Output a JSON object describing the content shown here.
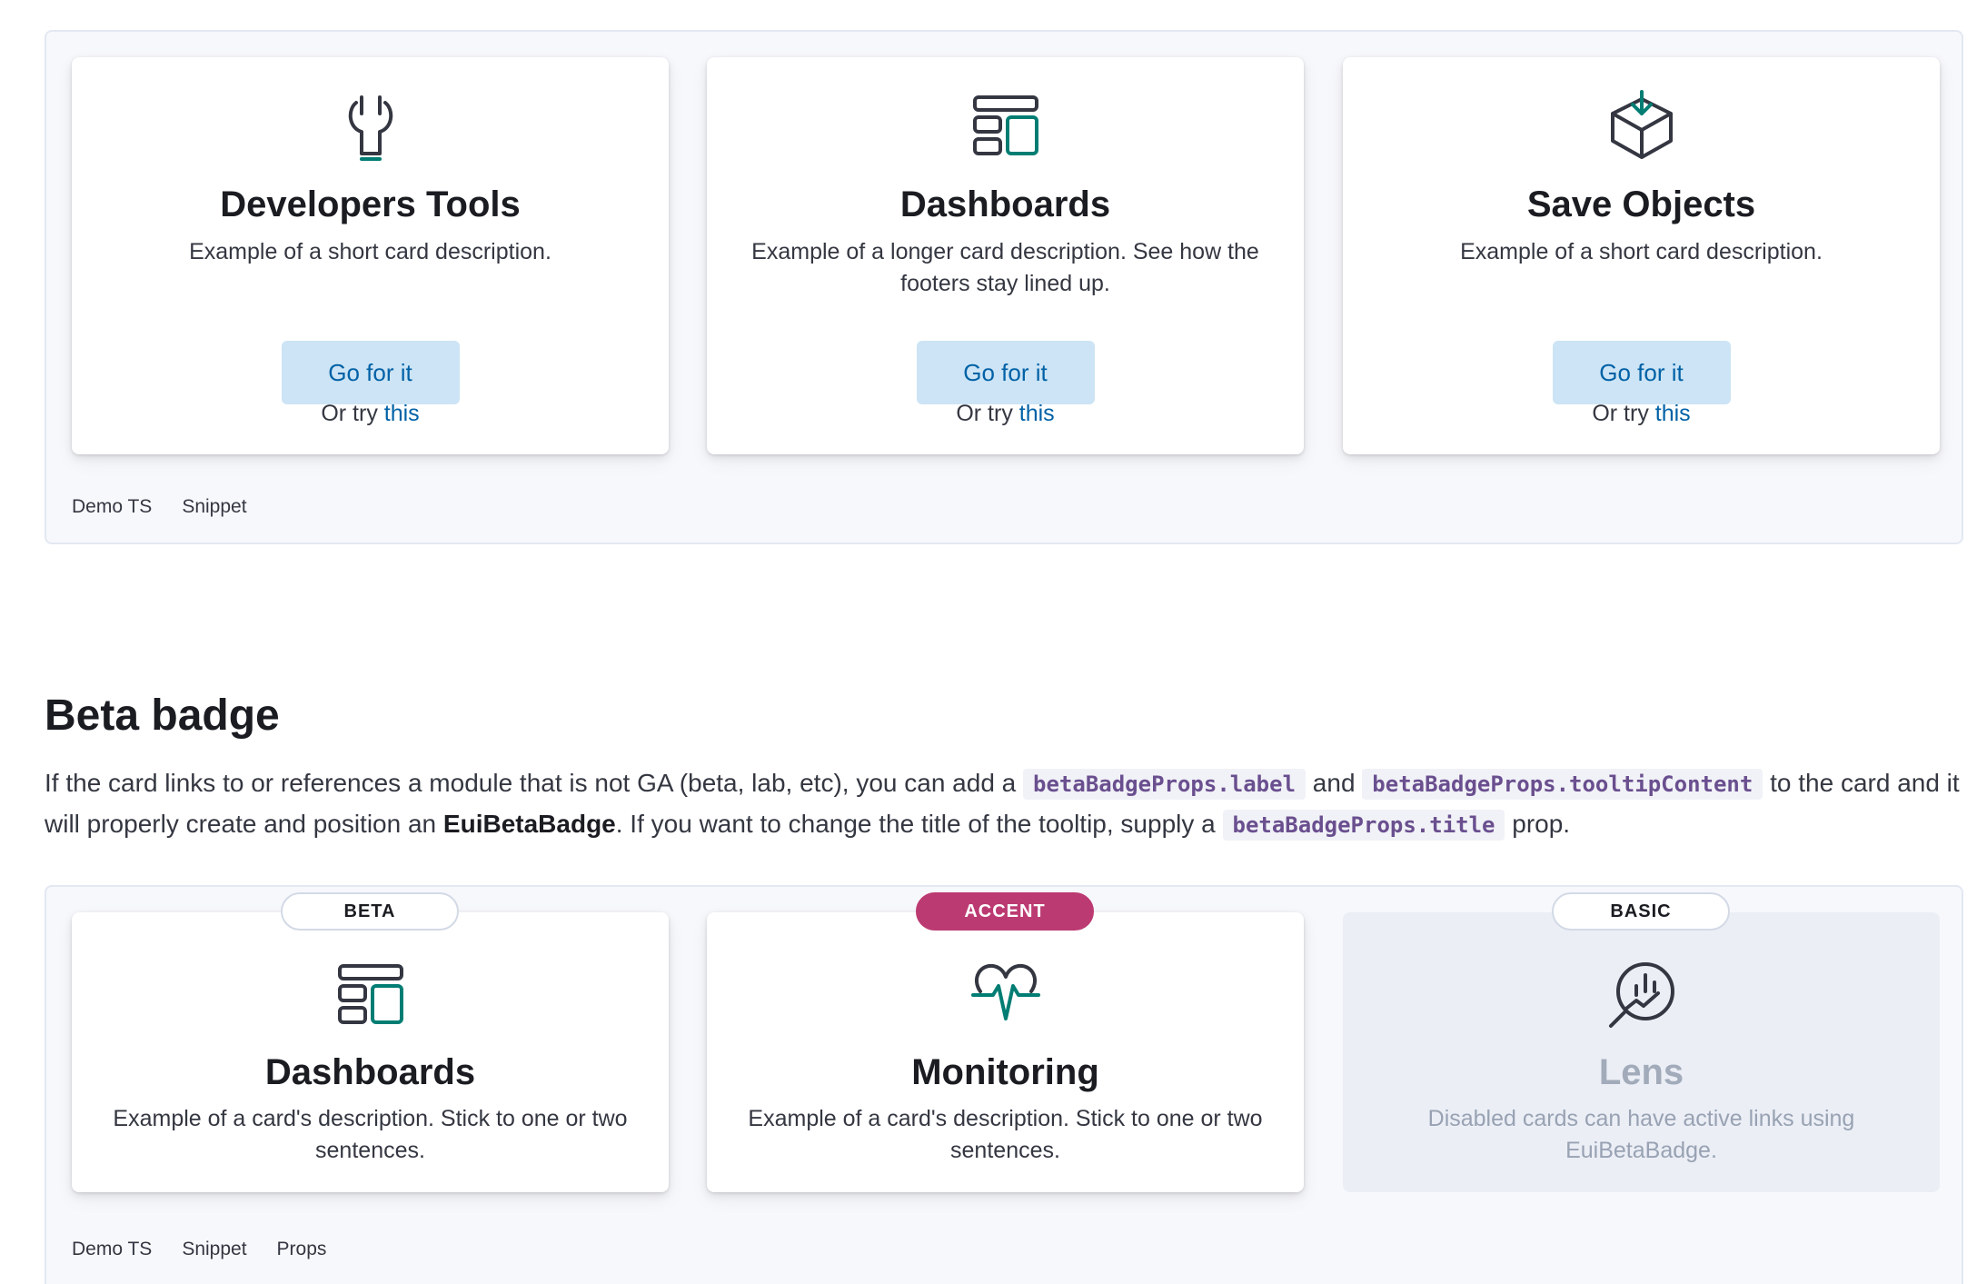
{
  "colors": {
    "primary": "#0061a6",
    "button_bg": "#cce4f5",
    "accent_badge": "#bc3a72",
    "icon_teal": "#017d73",
    "text_dark": "#1a1c21",
    "disabled_text": "#98a2b3",
    "code_text": "#6a4f8f"
  },
  "top_demo": {
    "cards": [
      {
        "icon": "wrench-icon",
        "title": "Developers Tools",
        "description": "Example of a short card description.",
        "button_label": "Go for it",
        "footer_prefix": "Or try ",
        "footer_link": "this"
      },
      {
        "icon": "dashboard-icon",
        "title": "Dashboards",
        "description": "Example of a longer card description. See how the footers stay lined up.",
        "button_label": "Go for it",
        "footer_prefix": "Or try ",
        "footer_link": "this"
      },
      {
        "icon": "save-objects-icon",
        "title": "Save Objects",
        "description": "Example of a short card description.",
        "button_label": "Go for it",
        "footer_prefix": "Or try ",
        "footer_link": "this"
      }
    ],
    "tabs": [
      "Demo TS",
      "Snippet"
    ]
  },
  "beta_section": {
    "title": "Beta badge",
    "desc": {
      "p1": "If the card links to or references a module that is not GA (beta, lab, etc), you can add a ",
      "code1": "betaBadgeProps.label",
      "p2": " and ",
      "code2": "betaBadgeProps.tooltipContent",
      "p3": " to the card and it will properly create and position an ",
      "strong": "EuiBetaBadge",
      "p4": ". If you want to change the title of the tooltip, supply a ",
      "code3": "betaBadgeProps.title",
      "p5": " prop."
    },
    "cards": [
      {
        "badge": "BETA",
        "icon": "dashboard-icon",
        "title": "Dashboards",
        "description": "Example of a card's description. Stick to one or two sentences."
      },
      {
        "badge": "ACCENT",
        "icon": "heart-monitor-icon",
        "title": "Monitoring",
        "description": "Example of a card's description. Stick to one or two sentences."
      },
      {
        "badge": "BASIC",
        "icon": "lens-icon",
        "title": "Lens",
        "description": "Disabled cards can have active links using EuiBetaBadge.",
        "disabled": true
      }
    ],
    "tabs": [
      "Demo TS",
      "Snippet",
      "Props"
    ]
  }
}
